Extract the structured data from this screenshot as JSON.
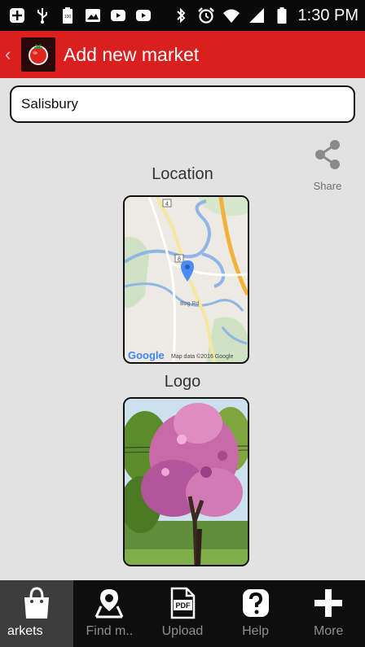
{
  "status_bar": {
    "time": "1:30 PM",
    "battery_level": "100",
    "icons": [
      "add-icon",
      "usb-icon",
      "battery-full-icon",
      "image-icon",
      "youtube-icon",
      "youtube-icon",
      "bluetooth-icon",
      "alarm-icon",
      "wifi-icon",
      "signal-icon",
      "battery-icon"
    ]
  },
  "app_bar": {
    "back_glyph": "‹",
    "title": "Add new market",
    "background": "#d9201e"
  },
  "form": {
    "market_name": "Salisbury"
  },
  "share": {
    "label": "Share"
  },
  "location": {
    "label": "Location",
    "map_road_1": "4",
    "map_road_2": "8",
    "map_road_label": "Bog Rd",
    "map_brand": "Google",
    "map_attribution": "Map data ©2016 Google"
  },
  "logo": {
    "label": "Logo"
  },
  "tabs": [
    {
      "label": "arkets",
      "icon": "shopping-bag-icon",
      "active": true
    },
    {
      "label": "Find m..",
      "icon": "map-pin-icon",
      "active": false
    },
    {
      "label": "Upload",
      "icon": "pdf-icon",
      "active": false
    },
    {
      "label": "Help",
      "icon": "help-icon",
      "active": false
    },
    {
      "label": "More",
      "icon": "plus-icon",
      "active": false
    }
  ],
  "colors": {
    "accent": "#d9201e",
    "background": "#e2e2e2",
    "tab_bar": "#0e0e0e"
  }
}
